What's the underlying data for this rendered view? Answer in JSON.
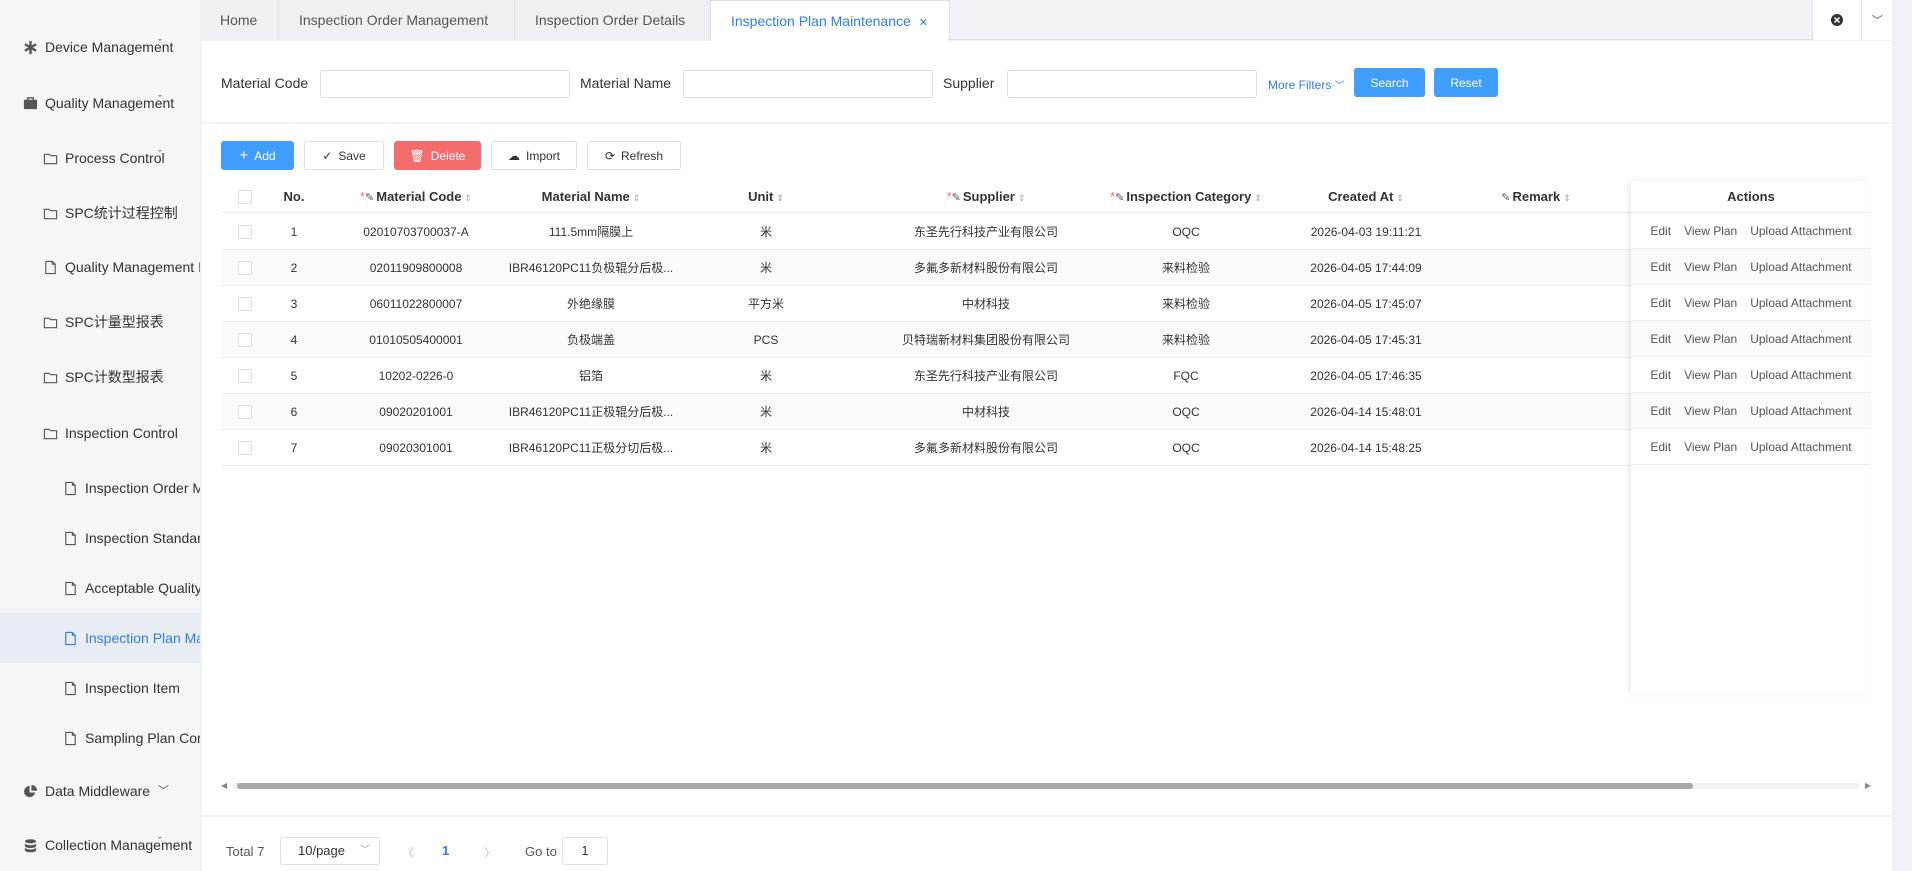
{
  "sidebar": {
    "items": [
      {
        "label": "Device Management",
        "icon": "asterisk-icon"
      },
      {
        "label": "Quality Management",
        "icon": "briefcase-icon"
      },
      {
        "label": "Process Control",
        "icon": "folder-icon"
      },
      {
        "label": "SPC统计过程控制",
        "icon": "folder-icon"
      },
      {
        "label": "Quality Management I",
        "icon": "document-icon"
      },
      {
        "label": "SPC计量型报表",
        "icon": "folder-icon"
      },
      {
        "label": "SPC计数型报表",
        "icon": "folder-icon"
      },
      {
        "label": "Inspection Control",
        "icon": "folder-icon"
      },
      {
        "label": "Inspection Order M",
        "icon": "document-icon"
      },
      {
        "label": "Inspection Standar",
        "icon": "document-icon"
      },
      {
        "label": "Acceptable Quality",
        "icon": "document-icon"
      },
      {
        "label": "Inspection Plan Ma",
        "icon": "document-icon"
      },
      {
        "label": "Inspection Item",
        "icon": "document-icon"
      },
      {
        "label": "Sampling Plan Con",
        "icon": "document-icon"
      },
      {
        "label": "Data Middleware",
        "icon": "pie-chart-icon"
      },
      {
        "label": "Collection Management",
        "icon": "database-icon"
      }
    ]
  },
  "tabs": [
    {
      "label": "Home"
    },
    {
      "label": "Inspection Order Management"
    },
    {
      "label": "Inspection Order Details"
    },
    {
      "label": "Inspection Plan Maintenance"
    }
  ],
  "filters": {
    "material_code_label": "Material Code",
    "material_name_label": "Material Name",
    "supplier_label": "Supplier",
    "more_filters": "More Filters",
    "search": "Search",
    "reset": "Reset"
  },
  "toolbar": {
    "add": "Add",
    "save": "Save",
    "delete": "Delete",
    "import": "Import",
    "refresh": "Refresh"
  },
  "table": {
    "columns": {
      "no": "No.",
      "material_code": "Material Code",
      "material_name": "Material Name",
      "unit": "Unit",
      "supplier": "Supplier",
      "inspection_category": "Inspection Category",
      "created_at": "Created At",
      "remark": "Remark",
      "actions": "Actions"
    },
    "rows": [
      {
        "no": "1",
        "code": "02010703700037-A",
        "name": "111.5mm隔膜上",
        "unit": "米",
        "supplier": "东圣先行科技产业有限公司",
        "category": "OQC",
        "created": "2026-04-03 19:11:21",
        "remark": ""
      },
      {
        "no": "2",
        "code": "02011909800008",
        "name": "IBR46120PC11负极辊分后极...",
        "unit": "米",
        "supplier": "多氟多新材料股份有限公司",
        "category": "来料检验",
        "created": "2026-04-05 17:44:09",
        "remark": ""
      },
      {
        "no": "3",
        "code": "06011022800007",
        "name": "外绝缘膜",
        "unit": "平方米",
        "supplier": "中材科技",
        "category": "来料检验",
        "created": "2026-04-05 17:45:07",
        "remark": ""
      },
      {
        "no": "4",
        "code": "01010505400001",
        "name": "负极端盖",
        "unit": "PCS",
        "supplier": "贝特瑞新材料集团股份有限公司",
        "category": "来料检验",
        "created": "2026-04-05 17:45:31",
        "remark": ""
      },
      {
        "no": "5",
        "code": "10202-0226-0",
        "name": "铝箔",
        "unit": "米",
        "supplier": "东圣先行科技产业有限公司",
        "category": "FQC",
        "created": "2026-04-05 17:46:35",
        "remark": ""
      },
      {
        "no": "6",
        "code": "09020201001",
        "name": "IBR46120PC11正极辊分后极...",
        "unit": "米",
        "supplier": "中材科技",
        "category": "OQC",
        "created": "2026-04-14 15:48:01",
        "remark": ""
      },
      {
        "no": "7",
        "code": "09020301001",
        "name": "IBR46120PC11正极分切后极...",
        "unit": "米",
        "supplier": "多氟多新材料股份有限公司",
        "category": "OQC",
        "created": "2026-04-14 15:48:25",
        "remark": ""
      }
    ],
    "row_actions": {
      "edit": "Edit",
      "view_plan": "View Plan",
      "upload": "Upload Attachment"
    }
  },
  "pagination": {
    "total": "Total 7",
    "page_size": "10/page",
    "current_page": "1",
    "goto_label": "Go to",
    "goto_value": "1"
  }
}
